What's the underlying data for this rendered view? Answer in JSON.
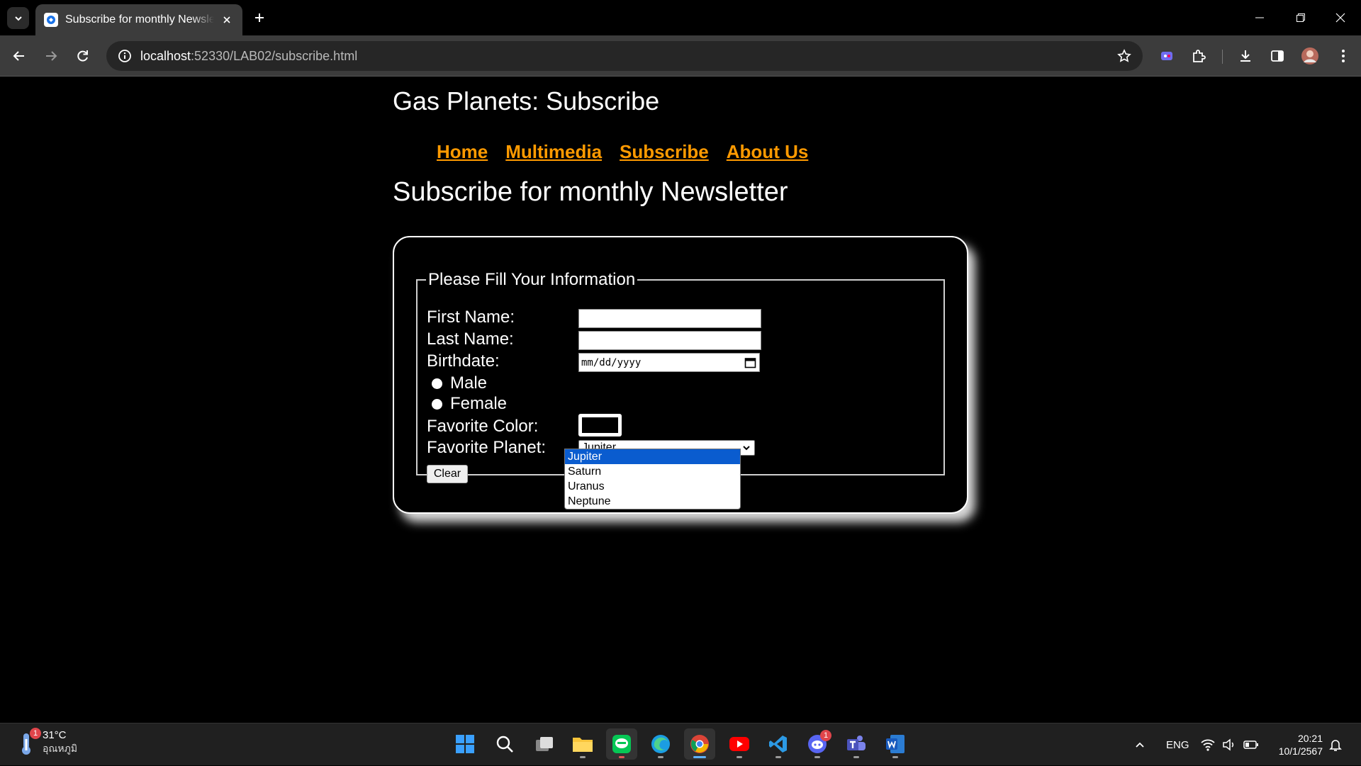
{
  "browser": {
    "tab_title": "Subscribe for monthly Newsletter",
    "url_host": "localhost",
    "url_rest": ":52330/LAB02/subscribe.html"
  },
  "page": {
    "site_title": "Gas Planets: Subscribe",
    "nav": [
      "Home",
      "Multimedia",
      "Subscribe",
      "About Us"
    ],
    "heading": "Subscribe for monthly Newsletter",
    "form": {
      "legend": "Please Fill Your Information",
      "first_name_label": "First Name:",
      "last_name_label": "Last Name:",
      "birthdate_label": "Birthdate:",
      "birthdate_placeholder": "mm/dd/yyyy",
      "gender_options": [
        "Male",
        "Female"
      ],
      "favorite_color_label": "Favorite Color:",
      "favorite_color_value": "#000000",
      "favorite_planet_label": "Favorite Planet:",
      "favorite_planet_selected": "Jupiter",
      "planet_options": [
        "Jupiter",
        "Saturn",
        "Uranus",
        "Neptune"
      ],
      "clear_label": "Clear"
    }
  },
  "taskbar": {
    "weather_temp": "31°C",
    "weather_desc": "อุณหภูมิ",
    "weather_badge": "1",
    "discord_badge": "1",
    "language": "ENG",
    "time": "20:21",
    "date": "10/1/2567"
  },
  "colors": {
    "nav_link": "#ff9a00",
    "selected_option": "#0a5ccf"
  }
}
